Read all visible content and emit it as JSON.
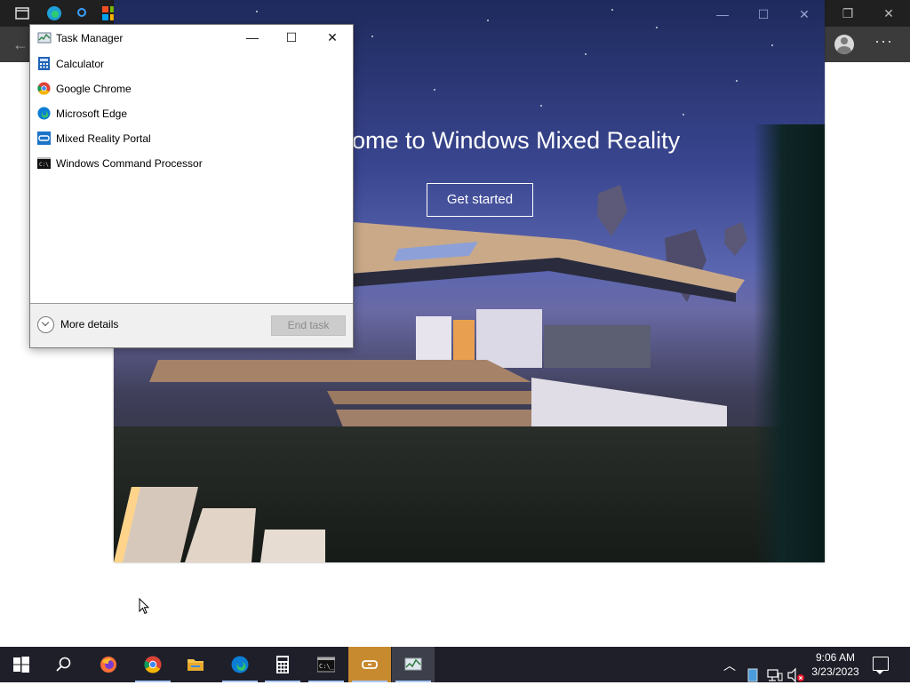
{
  "task_manager": {
    "title": "Task Manager",
    "apps": [
      {
        "label": "Calculator",
        "icon": "calculator-icon"
      },
      {
        "label": "Google Chrome",
        "icon": "chrome-icon"
      },
      {
        "label": "Microsoft Edge",
        "icon": "edge-icon"
      },
      {
        "label": "Mixed Reality Portal",
        "icon": "mixed-reality-icon"
      },
      {
        "label": "Windows Command Processor",
        "icon": "cmd-icon"
      }
    ],
    "more_details": "More details",
    "end_task": "End task"
  },
  "mixed_reality": {
    "welcome": "ome to Windows Mixed Reality",
    "get_started": "Get started"
  },
  "taskbar": {
    "time": "9:06 AM",
    "date": "3/23/2023"
  },
  "colors": {
    "accent": "#c88a2e",
    "taskbar": "#1f1f2a",
    "edge_toolbar": "#3b3b3b"
  }
}
